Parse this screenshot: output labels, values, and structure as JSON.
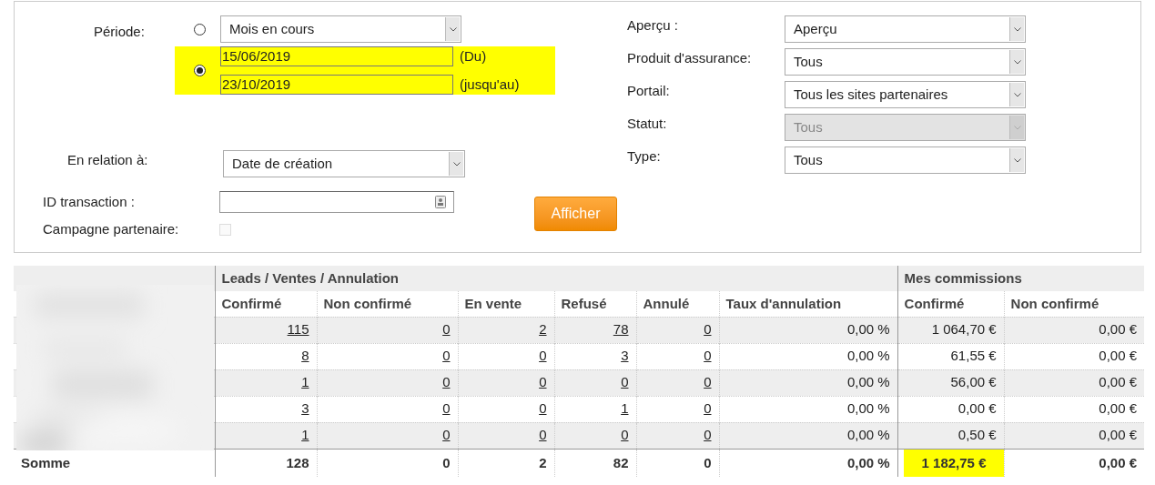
{
  "filters_left": {
    "period": {
      "label": "Période:",
      "options": [
        {
          "kind": "select",
          "selected": false,
          "value": "Mois en cours"
        },
        {
          "kind": "range",
          "selected": true,
          "highlighted": true,
          "from": {
            "value": "15/06/2019",
            "suffix": "(Du)"
          },
          "to": {
            "value": "23/10/2019",
            "suffix": "(jusqu'au)"
          }
        }
      ]
    },
    "relation": {
      "label": "En relation à:",
      "value": "Date de création"
    },
    "transaction_id": {
      "label": "ID transaction :"
    },
    "partner_campaign": {
      "label": "Campagne partenaire:",
      "checked": false,
      "disabled": true
    },
    "submit": "Afficher"
  },
  "filters_right": [
    {
      "label": "Aperçu :",
      "value": "Aperçu",
      "disabled": false
    },
    {
      "label": "Produit d'assurance:",
      "value": "Tous",
      "disabled": false
    },
    {
      "label": "Portail:",
      "value": "Tous les sites partenaires",
      "disabled": false
    },
    {
      "label": "Statut:",
      "value": "Tous",
      "disabled": true
    },
    {
      "label": "Type:",
      "value": "Tous",
      "disabled": false
    }
  ],
  "table": {
    "groups": [
      {
        "label": "Leads / Ventes / Annulation"
      },
      {
        "label": "Mes commissions"
      }
    ],
    "columns": [
      {
        "label": "Confirmé",
        "kind": "link"
      },
      {
        "label": "Non confirmé",
        "kind": "link"
      },
      {
        "label": "En vente",
        "kind": "link"
      },
      {
        "label": "Refusé",
        "kind": "link"
      },
      {
        "label": "Annulé",
        "kind": "link"
      },
      {
        "label": "Taux d'annulation",
        "kind": "plain"
      },
      {
        "label": "Confirmé",
        "kind": "plain"
      },
      {
        "label": "Non confirmé",
        "kind": "plain"
      }
    ],
    "rows": [
      {
        "cells": [
          "115",
          "0",
          "2",
          "78",
          "0",
          "0,00 %",
          "1 064,70 €",
          "0,00 €"
        ]
      },
      {
        "cells": [
          "8",
          "0",
          "0",
          "3",
          "0",
          "0,00 %",
          "61,55 €",
          "0,00 €"
        ]
      },
      {
        "cells": [
          "1",
          "0",
          "0",
          "0",
          "0",
          "0,00 %",
          "56,00 €",
          "0,00 €"
        ]
      },
      {
        "cells": [
          "3",
          "0",
          "0",
          "1",
          "0",
          "0,00 %",
          "0,00 €",
          "0,00 €"
        ]
      },
      {
        "cells": [
          "1",
          "0",
          "0",
          "0",
          "0",
          "0,00 %",
          "0,50 €",
          "0,00 €"
        ]
      }
    ],
    "total": {
      "label": "Somme",
      "cells": [
        {
          "text": "128",
          "highlighted": false
        },
        {
          "text": "0",
          "highlighted": false
        },
        {
          "text": "2",
          "highlighted": false
        },
        {
          "text": "82",
          "highlighted": false
        },
        {
          "text": "0",
          "highlighted": false
        },
        {
          "text": "0,00 %",
          "highlighted": false
        },
        {
          "text": "1 182,75 €",
          "highlighted": true
        },
        {
          "text": "0,00 €",
          "highlighted": false
        }
      ]
    }
  }
}
